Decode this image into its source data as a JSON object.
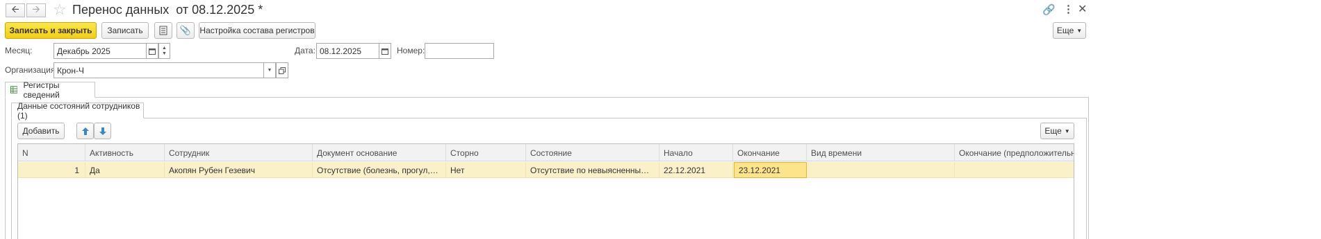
{
  "window": {
    "title": "Перенос данных  от 08.12.2025 *"
  },
  "toolbar": {
    "save_close_label": "Записать и закрыть",
    "save_label": "Записать",
    "settings_label": "Настройка состава регистров",
    "more_label": "Еще"
  },
  "form": {
    "month_label": "Месяц:",
    "month_value": "Декабрь 2025",
    "date_label": "Дата:",
    "date_value": "08.12.2025",
    "number_label": "Номер:",
    "number_value": "",
    "org_label": "Организация:",
    "org_value": "Крон-Ч"
  },
  "tabs": {
    "outer": "Регистры сведений",
    "inner": "Данные состояний сотрудников (1)"
  },
  "table_toolbar": {
    "add_label": "Добавить",
    "more_label": "Еще"
  },
  "table": {
    "columns": [
      "N",
      "Активность",
      "Сотрудник",
      "Документ основание",
      "Сторно",
      "Состояние",
      "Начало",
      "Окончание",
      "Вид времени",
      "Окончание (предположительно)"
    ],
    "rows": [
      {
        "n": "1",
        "active": "Да",
        "employee": "Акопян Рубен Гезевич",
        "document": "Отсутствие (болезнь, прогул, неявка)",
        "storno": "Нет",
        "state": "Отсутствие по невыясненным причинам",
        "start": "22.12.2021",
        "end": "23.12.2021",
        "time_kind": "",
        "end_expected": ""
      }
    ]
  }
}
